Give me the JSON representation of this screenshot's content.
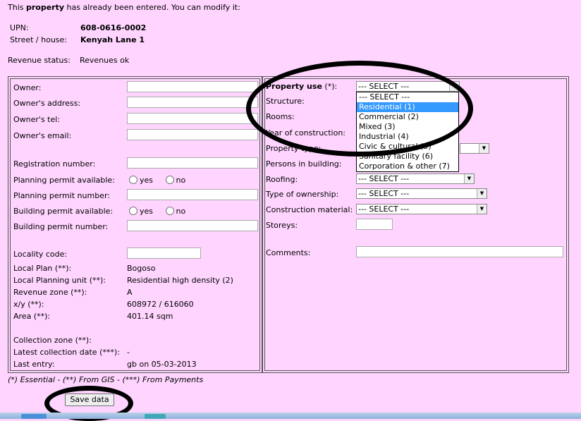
{
  "intro": {
    "pre": "This ",
    "bold": "property",
    "post": " has already been entered. You can modify it:"
  },
  "header": {
    "upn_label": "UPN:",
    "upn_value": "608-0616-0002",
    "street_label": "Street / house:",
    "street_value": "Kenyah Lane 1",
    "revenue_label": "Revenue status:",
    "revenue_value": "Revenues ok"
  },
  "left": {
    "owner": "Owner:",
    "owner_address": "Owner's address:",
    "owner_tel": "Owner's tel:",
    "owner_email": "Owner's email:",
    "registration_number": "Registration number:",
    "planning_permit_available": "Planning permit available:",
    "planning_permit_number": "Planning permit number:",
    "building_permit_available": "Building permit available:",
    "building_permit_number": "Building permit number:",
    "radio_yes": "yes",
    "radio_no": "no",
    "locality_code": "Locality code:",
    "local_plan_label": "Local Plan (**):",
    "local_plan_value": "Bogoso",
    "local_planning_unit_label": "Local Planning unit (**):",
    "local_planning_unit_value": "Residential high density (2)",
    "revenue_zone_label": "Revenue zone (**):",
    "revenue_zone_value": "A",
    "xy_label": "x/y (**):",
    "xy_value": "608972 / 616060",
    "area_label": "Area (**):",
    "area_value": "401.14 sqm",
    "collection_zone_label": "Collection zone (**):",
    "latest_collection_label": "Latest collection date (***):",
    "latest_collection_value": "-",
    "last_entry_label": "Last entry:",
    "last_entry_value": "gb on 05-03-2013"
  },
  "right": {
    "property_use_bold": "Property use",
    "property_use_rest": " (*):",
    "structure": "Structure:",
    "rooms": "Rooms:",
    "year_of_construction": "Year of construction:",
    "property_type": "Property type:",
    "persons_in_building": "Persons in building:",
    "roofing": "Roofing:",
    "type_of_ownership": "Type of ownership:",
    "construction_material": "Construction material:",
    "storeys": "Storeys:",
    "comments": "Comments:",
    "select_placeholder": "--- SELECT ---"
  },
  "property_use_options": [
    "--- SELECT ---",
    "Residential (1)",
    "Commercial (2)",
    "Mixed (3)",
    "Industrial (4)",
    "Civic & cultural (5)",
    "Sanitary facility (6)",
    "Corporation & other (7)"
  ],
  "property_use_selected_index": 1,
  "footer_note": "(*) Essential - (**) From GIS - (***) From Payments",
  "save_label": "Save data",
  "colors": {
    "page_bg": "#ffd5ff",
    "highlight": "#3399ff"
  }
}
